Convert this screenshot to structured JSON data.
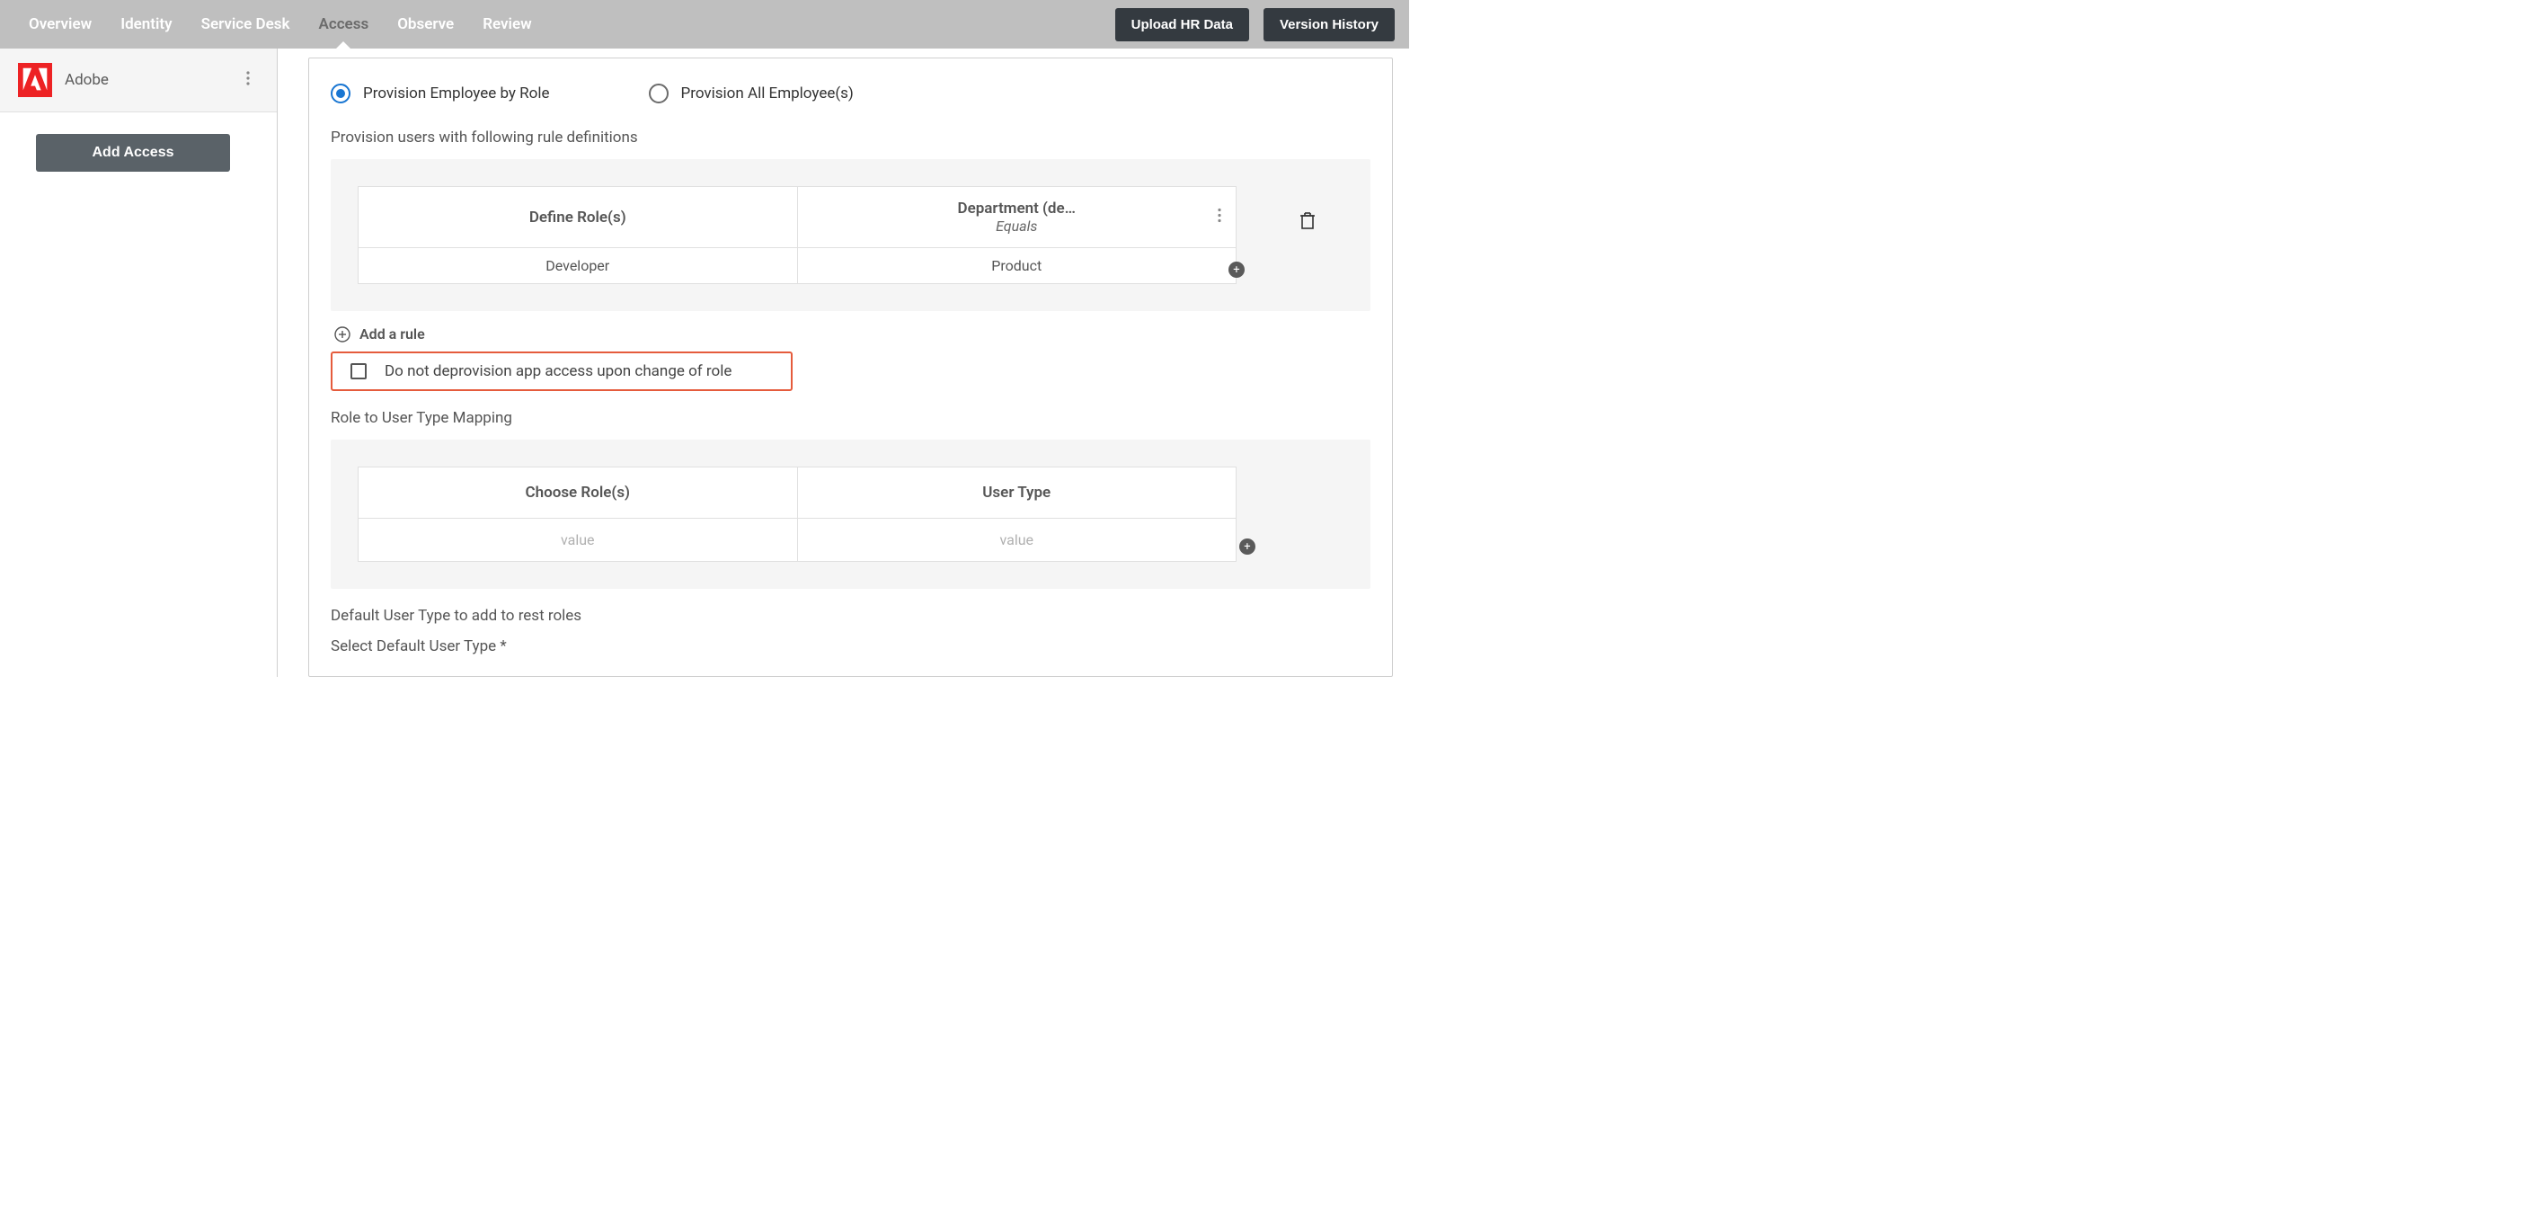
{
  "nav": {
    "tabs": [
      {
        "label": "Overview",
        "active": false
      },
      {
        "label": "Identity",
        "active": false
      },
      {
        "label": "Service Desk",
        "active": false
      },
      {
        "label": "Access",
        "active": true
      },
      {
        "label": "Observe",
        "active": false
      },
      {
        "label": "Review",
        "active": false
      }
    ],
    "upload_btn": "Upload HR Data",
    "version_btn": "Version History"
  },
  "sidebar": {
    "app_name": "Adobe",
    "add_access_btn": "Add Access"
  },
  "provision": {
    "radio_by_role": "Provision Employee by Role",
    "radio_all": "Provision All Employee(s)",
    "rules_heading": "Provision users with following rule definitions",
    "rules_table": {
      "col1_header": "Define Role(s)",
      "col2_header": "Department (de…",
      "col2_sub": "Equals",
      "row1_col1": "Developer",
      "row1_col2": "Product"
    },
    "add_rule_label": "Add a rule",
    "deprovision_checkbox_label": "Do not deprovision app access upon change of role"
  },
  "mapping": {
    "heading": "Role to User Type Mapping",
    "col1_header": "Choose Role(s)",
    "col2_header": "User Type",
    "placeholder": "value"
  },
  "default_user_type": {
    "heading": "Default User Type to add to rest roles",
    "select_label": "Select Default User Type *"
  }
}
